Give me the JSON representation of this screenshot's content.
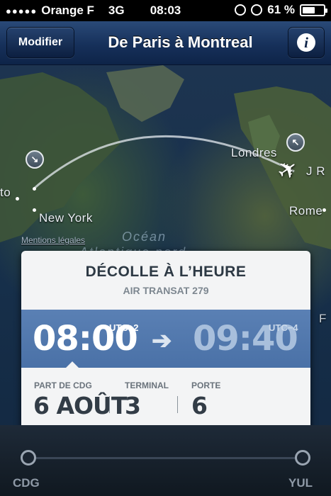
{
  "status_bar": {
    "carrier": "Orange F",
    "network": "3G",
    "time": "08:03",
    "battery": "61 %",
    "battery_level": 0.61
  },
  "nav": {
    "left_button": "Modifier",
    "title": "De Paris à Montreal",
    "info_button": "i"
  },
  "map": {
    "labels": {
      "london": "Londres",
      "rome": "Rome",
      "new_york": "New York",
      "toronto_partial": "to",
      "paris_partial": "J R",
      "ocean_line1": "Océan",
      "ocean_line2": "Atlantique nord",
      "right_edge": "F"
    },
    "legal_link": "Mentions légales"
  },
  "card": {
    "status": "DÉCOLLE À L’HEURE",
    "flight": "AIR TRANSAT 279",
    "departure_time": "08:00",
    "departure_tz": "UTC+2",
    "arrival_time": "09:40",
    "arrival_tz": "UTC−4",
    "arrow": "➔",
    "details": [
      {
        "label": "PART DE CDG",
        "value": "6 AOÛT"
      },
      {
        "label": "TERMINAL",
        "value": "3"
      },
      {
        "label": "PORTE",
        "value": "6"
      }
    ]
  },
  "timeline": {
    "origin": "CDG",
    "destination": "YUL",
    "progress": 0
  },
  "colors": {
    "nav_bg": "#16305a",
    "band_blue": "#4f76ab",
    "card_bg": "#f3f4f5"
  }
}
